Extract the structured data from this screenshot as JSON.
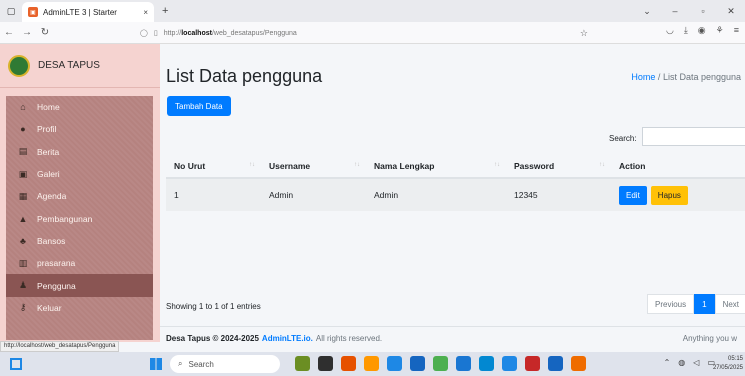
{
  "browser": {
    "tab_title": "AdminLTE 3 | Starter",
    "tab_close": "×",
    "new_tab": "+",
    "url_prefix": "http://",
    "url_host": "localhost",
    "url_path": "/web_desatapus/Pengguna",
    "status_url": "http://localhost/web_desatapus/Pengguna"
  },
  "sidebar": {
    "brand": "DESA TAPUS",
    "items": [
      {
        "label": "Home",
        "icon": "home-icon",
        "glyph": "⌂"
      },
      {
        "label": "Profil",
        "icon": "profile-icon",
        "glyph": "●"
      },
      {
        "label": "Berita",
        "icon": "news-icon",
        "glyph": "▤"
      },
      {
        "label": "Galeri",
        "icon": "gallery-icon",
        "glyph": "▣"
      },
      {
        "label": "Agenda",
        "icon": "calendar-icon",
        "glyph": "▦"
      },
      {
        "label": "Pembangunan",
        "icon": "building-icon",
        "glyph": "▲"
      },
      {
        "label": "Bansos",
        "icon": "aid-icon",
        "glyph": "♣"
      },
      {
        "label": "prasarana",
        "icon": "facility-icon",
        "glyph": "▥"
      },
      {
        "label": "Pengguna",
        "icon": "user-icon",
        "glyph": "♟"
      },
      {
        "label": "Keluar",
        "icon": "key-icon",
        "glyph": "⚷"
      }
    ]
  },
  "header": {
    "title": "List Data pengguna",
    "breadcrumb_home": "Home",
    "breadcrumb_sep": "/",
    "breadcrumb_current": "List Data pengguna"
  },
  "actions": {
    "add_label": "Tambah Data"
  },
  "table": {
    "search_label": "Search:",
    "columns": [
      "No Urut",
      "Username",
      "Nama Lengkap",
      "Password",
      "Action"
    ],
    "rows": [
      {
        "no": "1",
        "username": "Admin",
        "nama": "Admin",
        "password": "12345"
      }
    ],
    "edit_label": "Edit",
    "delete_label": "Hapus",
    "info": "Showing 1 to 1 of 1 entries",
    "pagination": {
      "previous": "Previous",
      "current": "1",
      "next": "Next"
    }
  },
  "footer": {
    "copyright": "Desa Tapus © 2024-2025",
    "brand": "AdminLTE.io.",
    "rights": "All rights reserved.",
    "right_text": "Anything you w"
  },
  "taskbar": {
    "search_placeholder": "Search",
    "time": "05:15",
    "date": "27/05/2025",
    "app_colors": [
      "#6b8e23",
      "#2f2f2f",
      "#e65100",
      "#ff9800",
      "#1e88e5",
      "#1565c0",
      "#4caf50",
      "#1976d2",
      "#0288d1",
      "#1e88e5",
      "#c62828",
      "#1565c0",
      "#ef6c00"
    ]
  },
  "colors": {
    "primary": "#007bff",
    "warning": "#ffc107",
    "sidebar_bg": "#f5d3d0",
    "menu_bg": "#b5827f"
  }
}
